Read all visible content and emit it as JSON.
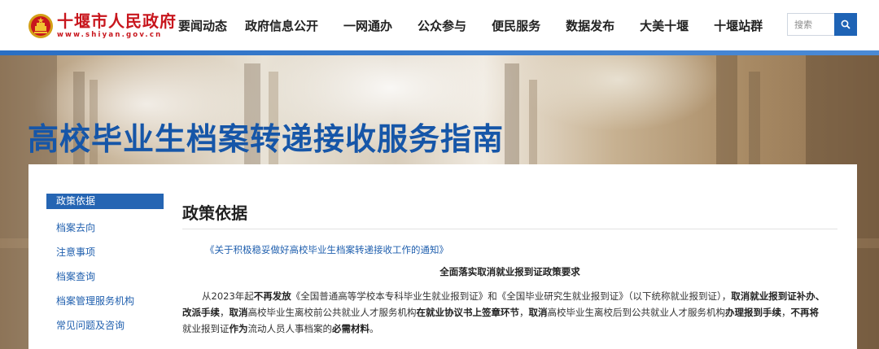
{
  "header": {
    "logo_cn": "十堰市人民政府",
    "logo_en": "www.shiyan.gov.cn",
    "nav": [
      "要闻动态",
      "政府信息公开",
      "一网通办",
      "公众参与",
      "便民服务",
      "数据发布",
      "大美十堰",
      "十堰站群"
    ],
    "search_placeholder": "搜索",
    "brand_color": "#c8161d",
    "accent_color": "#1e63b5"
  },
  "banner": {
    "title": "高校毕业生档案转递接收服务指南"
  },
  "sidebar": {
    "items": [
      "政策依据",
      "档案去向",
      "注意事项",
      "档案查询",
      "档案管理服务机构",
      "常见问题及咨询"
    ],
    "active": "政策依据"
  },
  "main": {
    "title": "政策依据",
    "doc_link": "《关于积极稳妥做好高校毕业生档案转递接收工作的通知》",
    "sub_title": "全面落实取消就业报到证政策要求",
    "para": {
      "s1": "从2023年起",
      "s2": "不再发放",
      "s3": "《全国普通高等学校本专科毕业生就业报到证》和《全国毕业研究生就业报到证》（以下统称就业报到证），",
      "s4": "取消就业报到证补办、改派手续",
      "s5": "，",
      "s6": "取消",
      "s7": "高校毕业生离校前公共就业人才服务机构",
      "s8": "在就业协议书上签章环节",
      "s9": "，",
      "s10": "取消",
      "s11": "高校毕业生离校后到公共就业人才服务机构",
      "s12": "办理报到手续",
      "s13": "，",
      "s14": "不再将",
      "s15": "就业报到证",
      "s16": "作为",
      "s17": "流动人员人事档案的",
      "s18": "必需材料",
      "s19": "。"
    }
  }
}
